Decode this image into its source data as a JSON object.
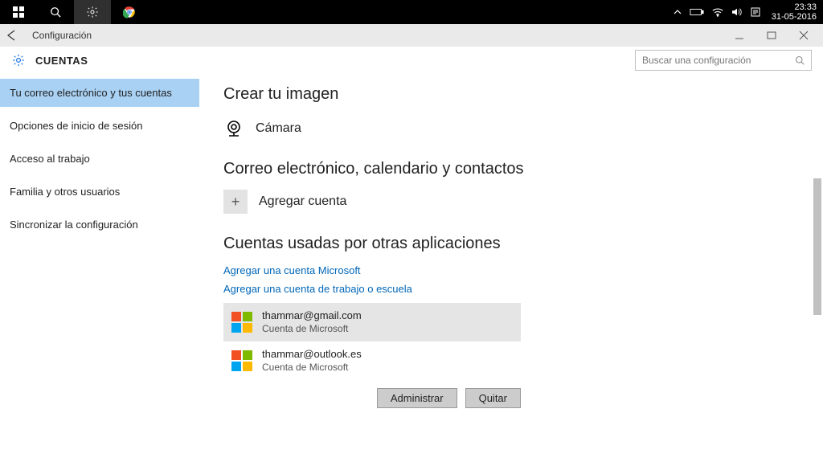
{
  "taskbar": {
    "time": "23:33",
    "date": "31-05-2016"
  },
  "window": {
    "title": "Configuración"
  },
  "header": {
    "section": "CUENTAS",
    "search_placeholder": "Buscar una configuración"
  },
  "sidebar": {
    "items": [
      {
        "label": "Tu correo electrónico y tus cuentas",
        "active": true
      },
      {
        "label": "Opciones de inicio de sesión",
        "active": false
      },
      {
        "label": "Acceso al trabajo",
        "active": false
      },
      {
        "label": "Familia y otros usuarios",
        "active": false
      },
      {
        "label": "Sincronizar la configuración",
        "active": false
      }
    ]
  },
  "main": {
    "create_image_heading": "Crear tu imagen",
    "camera_label": "Cámara",
    "email_heading": "Correo electrónico, calendario y contactos",
    "add_account": "Agregar cuenta",
    "other_apps_heading": "Cuentas usadas por otras aplicaciones",
    "link_add_ms": "Agregar una cuenta Microsoft",
    "link_add_workschool": "Agregar una cuenta de trabajo o escuela",
    "accounts": [
      {
        "email": "thammar@gmail.com",
        "kind": "Cuenta de Microsoft",
        "selected": true
      },
      {
        "email": "thammar@outlook.es",
        "kind": "Cuenta de Microsoft",
        "selected": false
      }
    ],
    "btn_manage": "Administrar",
    "btn_remove": "Quitar"
  }
}
